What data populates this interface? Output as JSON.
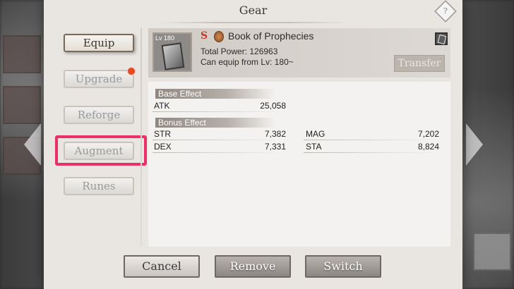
{
  "dialog": {
    "title": "Gear"
  },
  "tabs": [
    {
      "label": "Equip",
      "active": true
    },
    {
      "label": "Upgrade",
      "has_notification": true
    },
    {
      "label": "Reforge"
    },
    {
      "label": "Augment",
      "highlighted": true
    },
    {
      "label": "Runes"
    }
  ],
  "item": {
    "level": "Lv 180",
    "grade": "S",
    "name": "Book of Prophecies",
    "total_power": "Total Power: 126963",
    "equip_requirement": "Can equip from Lv: 180~",
    "transfer_label": "Transfer"
  },
  "base_effect": {
    "title": "Base Effect",
    "stats": [
      {
        "label": "ATK",
        "value": "25,058"
      }
    ]
  },
  "bonus_effect": {
    "title": "Bonus Effect",
    "stats": [
      {
        "label": "STR",
        "value": "7,382"
      },
      {
        "label": "MAG",
        "value": "7,202"
      },
      {
        "label": "DEX",
        "value": "7,331"
      },
      {
        "label": "STA",
        "value": "8,824"
      }
    ]
  },
  "buttons": {
    "cancel": "Cancel",
    "remove": "Remove",
    "switch": "Switch"
  },
  "colors": {
    "highlight": "#ea2f69",
    "grade": "#c7362a",
    "notification": "#e44a23"
  },
  "icons": [
    "help-icon",
    "book-icon",
    "medal-icon",
    "card-icon",
    "left-arrow-icon",
    "right-arrow-icon"
  ]
}
